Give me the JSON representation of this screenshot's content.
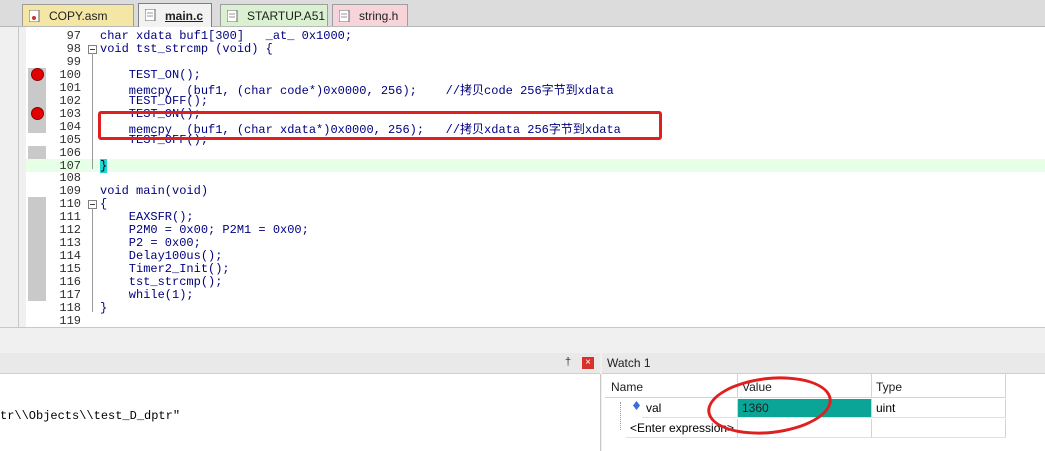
{
  "tabs": [
    {
      "label": "COPY.asm",
      "color": "#f4e7a6"
    },
    {
      "label": "main.c",
      "color": "#f2f2f2",
      "active": true
    },
    {
      "label": "STARTUP.A51",
      "color": "#d9f0d1"
    },
    {
      "label": "string.h",
      "color": "#f7d4da"
    }
  ],
  "editor": {
    "lines": [
      {
        "num": "97",
        "text": "char xdata buf1[300]   _at_ 0x1000;"
      },
      {
        "num": "98",
        "text": "void tst_strcmp (void) {"
      },
      {
        "num": "99",
        "text": ""
      },
      {
        "num": "100",
        "text": "    TEST_ON();"
      },
      {
        "num": "101",
        "text": "    memcpy  (buf1, (char code*)0x0000, 256);    //拷贝code 256字节到xdata"
      },
      {
        "num": "102",
        "text": "    TEST_OFF();"
      },
      {
        "num": "103",
        "text": "    TEST_ON();"
      },
      {
        "num": "104",
        "text": "    memcpy  (buf1, (char xdata*)0x0000, 256);   //拷贝xdata 256字节到xdata"
      },
      {
        "num": "105",
        "text": "    TEST_OFF();"
      },
      {
        "num": "106",
        "text": ""
      },
      {
        "num": "107",
        "text": "}"
      },
      {
        "num": "108",
        "text": ""
      },
      {
        "num": "109",
        "text": "void main(void)"
      },
      {
        "num": "110",
        "text": "{"
      },
      {
        "num": "111",
        "text": "    EAXSFR();"
      },
      {
        "num": "112",
        "text": "    P2M0 = 0x00; P2M1 = 0x00;"
      },
      {
        "num": "113",
        "text": "    P2 = 0x00;"
      },
      {
        "num": "114",
        "text": "    Delay100us();"
      },
      {
        "num": "115",
        "text": "    Timer2_Init();"
      },
      {
        "num": "116",
        "text": "    tst_strcmp();"
      },
      {
        "num": "117",
        "text": "    while(1);"
      },
      {
        "num": "118",
        "text": "}"
      },
      {
        "num": "119",
        "text": ""
      }
    ]
  },
  "command": {
    "pin": "†",
    "close": "×",
    "text": "tr\\\\Objects\\\\test_D_dptr\""
  },
  "watch": {
    "title": "Watch 1",
    "columns": {
      "name": "Name",
      "value": "Value",
      "type": "Type"
    },
    "rows": [
      {
        "name": "val",
        "value": "1360",
        "type": "uint"
      },
      {
        "name": "<Enter expression>",
        "value": "",
        "type": ""
      }
    ]
  },
  "colors": {
    "breakpoint": "#e30000",
    "highlight_value": "#0aa596",
    "annotation": "#e02020",
    "current_line": "#e6ffe6"
  }
}
